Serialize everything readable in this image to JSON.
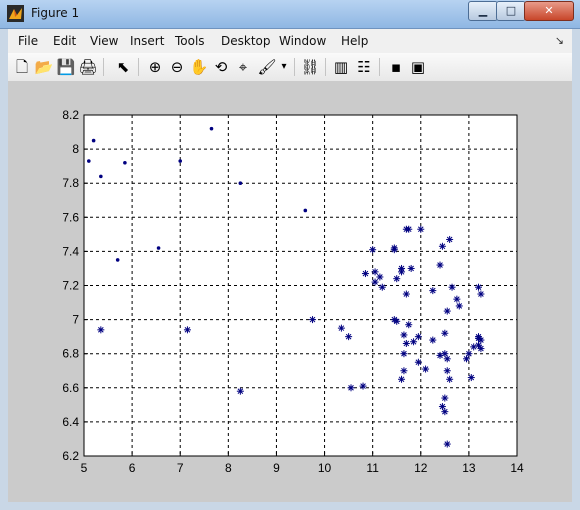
{
  "window": {
    "title": "Figure 1",
    "controls": {
      "minimize_icon": "minimize-icon",
      "maximize_icon": "maximize-icon",
      "close_icon": "close-icon"
    }
  },
  "menu": {
    "items": [
      "File",
      "Edit",
      "View",
      "Insert",
      "Tools",
      "Desktop",
      "Window",
      "Help"
    ],
    "overflow": "↘"
  },
  "toolbar": {
    "icons": [
      "new-figure-icon",
      "open-file-icon",
      "save-icon",
      "print-icon",
      "select-arrow-icon",
      "zoom-in-icon",
      "zoom-out-icon",
      "pan-hand-icon",
      "rotate-3d-icon",
      "data-cursor-icon",
      "brush-icon",
      "link-plot-icon",
      "colorbar-icon",
      "legend-icon",
      "hide-plot-tools-icon",
      "show-plot-tools-icon"
    ]
  },
  "colors": {
    "titlebar_top": "#b7d3f1",
    "titlebar_bottom": "#8fb7e3",
    "figure_bg": "#cbcbcb",
    "axes_bg": "#ffffff",
    "marker": "#000080"
  },
  "chart_data": {
    "type": "scatter",
    "xlim": [
      5,
      14
    ],
    "ylim": [
      6.2,
      8.2
    ],
    "xticks": [
      "5",
      "6",
      "7",
      "8",
      "9",
      "10",
      "11",
      "12",
      "13",
      "14"
    ],
    "yticks": [
      "6.2",
      "6.4",
      "6.6",
      "6.8",
      "7",
      "7.2",
      "7.4",
      "7.6",
      "7.8",
      "8",
      "8.2"
    ],
    "grid": true,
    "series": [
      {
        "marker": "dot",
        "x": [
          5.1,
          5.2,
          5.35,
          5.85,
          5.7,
          6.55,
          7.0,
          7.65,
          8.25,
          9.6
        ],
        "y": [
          7.93,
          8.05,
          7.84,
          7.92,
          7.35,
          7.42,
          7.93,
          8.12,
          7.8,
          7.64
        ]
      },
      {
        "marker": "star",
        "x": [
          5.35,
          7.15,
          8.25,
          9.75,
          10.35,
          10.5,
          10.55,
          10.85,
          10.8,
          11.0,
          11.05,
          11.05,
          11.2,
          11.15,
          11.45,
          11.45,
          11.5,
          11.6,
          11.6,
          11.7,
          11.7,
          11.75,
          11.8,
          11.85,
          11.95,
          11.95,
          12.0,
          11.45,
          11.5,
          11.6,
          11.65,
          11.65,
          11.7,
          11.75,
          11.65,
          12.1,
          12.25,
          12.25,
          12.4,
          12.45,
          12.5,
          12.5,
          12.55,
          12.6,
          12.65,
          12.75,
          12.8,
          12.95,
          13.0,
          13.05,
          13.1,
          13.2,
          13.2,
          13.25,
          13.2,
          13.25,
          13.2,
          13.25,
          12.45,
          12.5,
          12.55,
          12.6,
          12.55,
          12.4,
          12.5,
          12.55
        ],
        "y": [
          6.94,
          6.94,
          6.58,
          7.0,
          6.95,
          6.9,
          6.6,
          7.27,
          6.61,
          7.41,
          7.28,
          7.22,
          7.19,
          7.25,
          7.41,
          7.42,
          7.24,
          7.28,
          7.3,
          7.53,
          7.15,
          7.53,
          7.3,
          6.87,
          6.75,
          6.9,
          7.53,
          7.0,
          6.99,
          6.65,
          6.7,
          6.8,
          6.86,
          6.97,
          6.91,
          6.71,
          6.88,
          7.17,
          6.79,
          7.43,
          6.92,
          6.8,
          6.7,
          6.65,
          7.19,
          7.12,
          7.08,
          6.77,
          6.8,
          6.66,
          6.84,
          6.89,
          6.9,
          6.88,
          6.85,
          6.83,
          7.19,
          7.15,
          6.49,
          6.46,
          6.27,
          7.47,
          7.05,
          7.32,
          6.54,
          6.77
        ]
      }
    ]
  }
}
